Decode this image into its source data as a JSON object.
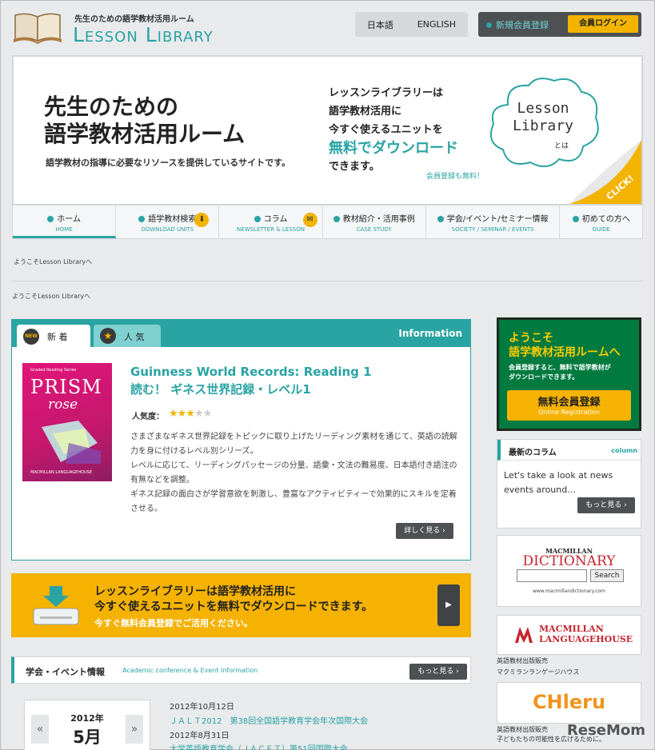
{
  "header": {
    "tagline": "先生のための語学教材活用ルーム",
    "logo_text": "Lesson Library",
    "lang_ja": "日本語",
    "lang_en": "ENGLISH",
    "register": "新規会員登録",
    "login": "会員ログイン"
  },
  "hero": {
    "title_line1": "先生のための",
    "title_line2": "語学教材活用ルーム",
    "subtitle": "語学教材の指導に必要なリソースを提供しているサイトです。",
    "mid_line1": "レッスンライブラリーは",
    "mid_line2": "語学教材活用に",
    "mid_line3": "今すぐ使えるユニットを",
    "mid_line4": "無料でダウンロード",
    "mid_line5": "できます。",
    "cloud_line1": "Lesson",
    "cloud_line2": "Library",
    "cloud_small": "とは",
    "free_note": "会員登録も無料！",
    "click": "CLICK!"
  },
  "nav": [
    {
      "label": "ホーム",
      "sub": "HOME"
    },
    {
      "label": "語学教材検索",
      "sub": "DOWNLOAD UNITS"
    },
    {
      "label": "コラム",
      "sub": "NEWSLETTER & LESSON"
    },
    {
      "label": "教材紹介・活用事例",
      "sub": "CASE STUDY"
    },
    {
      "label": "学会/イベント/セミナー情報",
      "sub": "SOCIETY / SEMINAR / EVENTS"
    },
    {
      "label": "初めての方へ",
      "sub": "GUIDE"
    }
  ],
  "welcome": "ようこそLesson Libraryへ",
  "feature": {
    "tab_new": "新 着",
    "tab_new_badge": "NEW",
    "tab_pop": "人 気",
    "info": "Information",
    "book_series": "Graded Reading Series",
    "book_prism": "PRISM",
    "book_rose": "rose",
    "book_pub": "MACMILLAN LANGUAGEHOUSE",
    "title_en": "Guinness World Records: Reading 1",
    "title_ja": "読む！ ギネス世界記録・レベル1",
    "popularity_label": "人気度：",
    "popularity": 3,
    "popularity_max": 5,
    "body": [
      "さまざまなギネス世界記録をトピックに取り上げたリーディング素材を通じて、英語の読解力を身に付けるレベル別シリーズ。",
      "レベルに応じて、リーディングパッセージの分量、語彙・文法の難易度、日本語付き語注の有無などを調整。",
      "ギネス記録の面白さが学習意欲を刺激し、豊富なアクティビティーで効果的にスキルを定着させる。"
    ],
    "more": "詳しく見る"
  },
  "banner": {
    "line1": "レッスンライブラリーは語学教材活用に",
    "line2": "今すぐ使えるユニットを無料でダウンロードできます。",
    "line3": "今すぐ無料会員登録でご活用ください。"
  },
  "events": {
    "title": "学会・イベント情報",
    "subtitle": "Academic conference & Event Information",
    "more": "もっと見る",
    "cal_year": "2012年",
    "cal_month": "5月",
    "items": [
      {
        "date": "2012年10月12日",
        "title": "ＪＡＬＴ2012　第38回全国語学教育学会年次国際大会"
      },
      {
        "date": "2012年8月31日",
        "title": "大学英語教育学会（ＪＡＣＥＴ）第51回国際大会"
      }
    ]
  },
  "sidebar": {
    "reg_line1": "ようこそ",
    "reg_line2": "語学教材活用ルームへ",
    "reg_desc1": "会員登録すると、無料で語学教材が",
    "reg_desc2": "ダウンロードできます。",
    "reg_btn": "無料会員登録",
    "reg_btn_sub": "Online Registration",
    "col_title": "最新のコラム",
    "col_en": "column",
    "col_body": "Let's take a look at news events around…",
    "col_more": "もっと見る",
    "dict_mac": "MACMILLAN",
    "dict_name": "DICTIONARY",
    "dict_search": "Search",
    "dict_url": "www.macmillandictionary.com",
    "mlh_line1": "MACMILLAN",
    "mlh_line2": "LANGUAGEHOUSE",
    "mlh_cap1": "英語教材出版販売",
    "mlh_cap2": "マクミランランゲージハウス",
    "chl_text": "CHleru",
    "chl_cap1": "英語教材出版販売",
    "chl_cap2": "子どもたちの可能性を広げるために。"
  },
  "watermark": "ReseMom",
  "colors": {
    "teal": "#2aa3a3",
    "yellow": "#f2b400",
    "dark": "#4d5154",
    "green": "#007a3f"
  }
}
